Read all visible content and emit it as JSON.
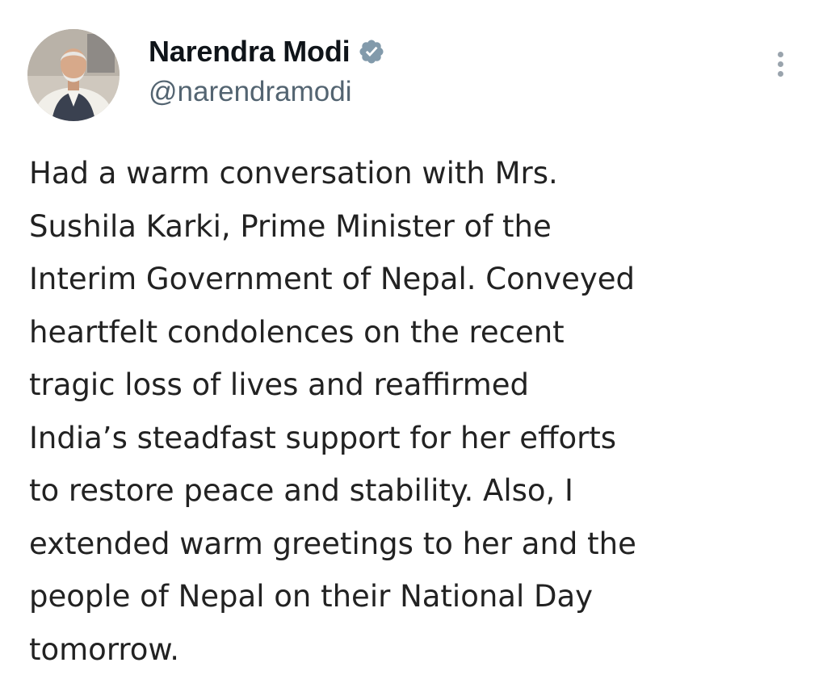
{
  "author": {
    "display_name": "Narendra Modi",
    "handle": "@narendramodi",
    "verified": true,
    "verified_badge_color": "#829aab",
    "avatar_icon": "profile-photo"
  },
  "menu": {
    "icon": "more-options-icon"
  },
  "tweet": {
    "lines": [
      "Had a warm conversation with Mrs.",
      "Sushila Karki, Prime Minister of the",
      "Interim Government of Nepal. Conveyed",
      "heartfelt condolences on the recent",
      "tragic loss of lives and reaffirmed",
      "India’s steadfast support for her efforts",
      "to restore peace and stability. Also, I",
      "extended warm greetings to her and the",
      "people of Nepal on their National Day",
      "tomorrow."
    ]
  }
}
